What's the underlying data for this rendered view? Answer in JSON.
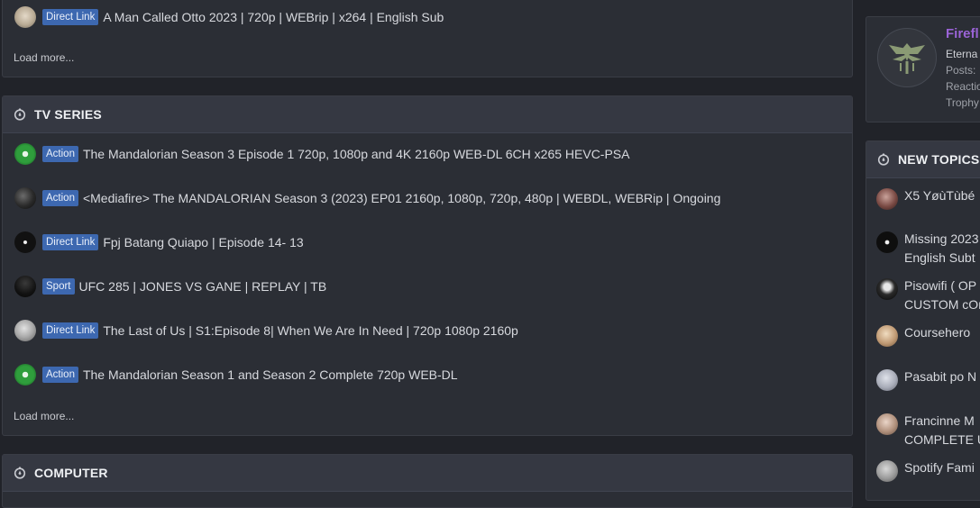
{
  "top_block": {
    "last_item": {
      "prefix": "Direct Link",
      "title": "A Man Called Otto 2023 | 720p | WEBrip | x264 | English Sub"
    },
    "load_more": "Load more..."
  },
  "tv_series": {
    "heading": "TV SERIES",
    "items": [
      {
        "prefix": "Action",
        "title": "The Mandalorian Season 3 Episode 1 720p, 1080p and 4K 2160p WEB-DL 6CH x265 HEVC-PSA"
      },
      {
        "prefix": "Action",
        "title": "<Mediafire> The MANDALORIAN Season 3 (2023) EP01 2160p, 1080p, 720p, 480p | WEBDL, WEBRip | Ongoing"
      },
      {
        "prefix": "Direct Link",
        "title": "Fpj Batang Quiapo | Episode 14- 13"
      },
      {
        "prefix": "Sport",
        "title": "UFC 285 | JONES VS GANE | REPLAY | TB"
      },
      {
        "prefix": "Direct Link",
        "title": "The Last of Us | S1:Episode 8| When We Are In Need | 720p 1080p 2160p"
      },
      {
        "prefix": "Action",
        "title": "The Mandalorian Season 1 and Season 2 Complete 720p WEB-DL"
      }
    ],
    "load_more": "Load more..."
  },
  "computer": {
    "heading": "COMPUTER"
  },
  "profile": {
    "name": "Firefl",
    "title": "Eterna",
    "stats": [
      "Posts:",
      "Reactio",
      "Trophy"
    ]
  },
  "new_topics": {
    "heading": "NEW TOPICS",
    "items": [
      {
        "title": "X5 YøùTùbé"
      },
      {
        "title": "Missing 2023\nEnglish Subt"
      },
      {
        "title": "Pisowifi ( OP\nCUSTOM cOr"
      },
      {
        "title": "Coursehero"
      },
      {
        "title": "Pasabit po N"
      },
      {
        "title": "Francinne M\nCOMPLETE U"
      },
      {
        "title": "Spotify Fami"
      }
    ]
  },
  "colors": {
    "prefix_bg": "#3d68b0",
    "profile_name": "#9a63d6",
    "page_bg": "#212329",
    "block_bg": "#2b2e35"
  }
}
